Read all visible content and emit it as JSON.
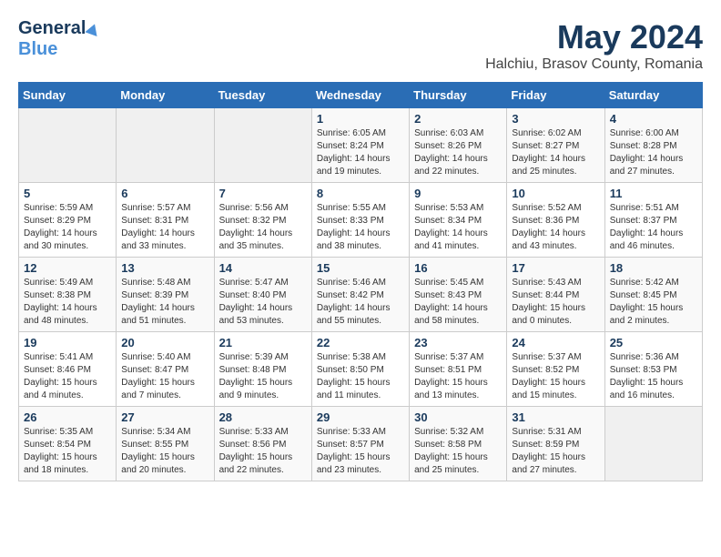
{
  "logo": {
    "general": "General",
    "blue": "Blue"
  },
  "header": {
    "month": "May 2024",
    "location": "Halchiu, Brasov County, Romania"
  },
  "weekdays": [
    "Sunday",
    "Monday",
    "Tuesday",
    "Wednesday",
    "Thursday",
    "Friday",
    "Saturday"
  ],
  "weeks": [
    [
      {
        "day": "",
        "info": ""
      },
      {
        "day": "",
        "info": ""
      },
      {
        "day": "",
        "info": ""
      },
      {
        "day": "1",
        "info": "Sunrise: 6:05 AM\nSunset: 8:24 PM\nDaylight: 14 hours\nand 19 minutes."
      },
      {
        "day": "2",
        "info": "Sunrise: 6:03 AM\nSunset: 8:26 PM\nDaylight: 14 hours\nand 22 minutes."
      },
      {
        "day": "3",
        "info": "Sunrise: 6:02 AM\nSunset: 8:27 PM\nDaylight: 14 hours\nand 25 minutes."
      },
      {
        "day": "4",
        "info": "Sunrise: 6:00 AM\nSunset: 8:28 PM\nDaylight: 14 hours\nand 27 minutes."
      }
    ],
    [
      {
        "day": "5",
        "info": "Sunrise: 5:59 AM\nSunset: 8:29 PM\nDaylight: 14 hours\nand 30 minutes."
      },
      {
        "day": "6",
        "info": "Sunrise: 5:57 AM\nSunset: 8:31 PM\nDaylight: 14 hours\nand 33 minutes."
      },
      {
        "day": "7",
        "info": "Sunrise: 5:56 AM\nSunset: 8:32 PM\nDaylight: 14 hours\nand 35 minutes."
      },
      {
        "day": "8",
        "info": "Sunrise: 5:55 AM\nSunset: 8:33 PM\nDaylight: 14 hours\nand 38 minutes."
      },
      {
        "day": "9",
        "info": "Sunrise: 5:53 AM\nSunset: 8:34 PM\nDaylight: 14 hours\nand 41 minutes."
      },
      {
        "day": "10",
        "info": "Sunrise: 5:52 AM\nSunset: 8:36 PM\nDaylight: 14 hours\nand 43 minutes."
      },
      {
        "day": "11",
        "info": "Sunrise: 5:51 AM\nSunset: 8:37 PM\nDaylight: 14 hours\nand 46 minutes."
      }
    ],
    [
      {
        "day": "12",
        "info": "Sunrise: 5:49 AM\nSunset: 8:38 PM\nDaylight: 14 hours\nand 48 minutes."
      },
      {
        "day": "13",
        "info": "Sunrise: 5:48 AM\nSunset: 8:39 PM\nDaylight: 14 hours\nand 51 minutes."
      },
      {
        "day": "14",
        "info": "Sunrise: 5:47 AM\nSunset: 8:40 PM\nDaylight: 14 hours\nand 53 minutes."
      },
      {
        "day": "15",
        "info": "Sunrise: 5:46 AM\nSunset: 8:42 PM\nDaylight: 14 hours\nand 55 minutes."
      },
      {
        "day": "16",
        "info": "Sunrise: 5:45 AM\nSunset: 8:43 PM\nDaylight: 14 hours\nand 58 minutes."
      },
      {
        "day": "17",
        "info": "Sunrise: 5:43 AM\nSunset: 8:44 PM\nDaylight: 15 hours\nand 0 minutes."
      },
      {
        "day": "18",
        "info": "Sunrise: 5:42 AM\nSunset: 8:45 PM\nDaylight: 15 hours\nand 2 minutes."
      }
    ],
    [
      {
        "day": "19",
        "info": "Sunrise: 5:41 AM\nSunset: 8:46 PM\nDaylight: 15 hours\nand 4 minutes."
      },
      {
        "day": "20",
        "info": "Sunrise: 5:40 AM\nSunset: 8:47 PM\nDaylight: 15 hours\nand 7 minutes."
      },
      {
        "day": "21",
        "info": "Sunrise: 5:39 AM\nSunset: 8:48 PM\nDaylight: 15 hours\nand 9 minutes."
      },
      {
        "day": "22",
        "info": "Sunrise: 5:38 AM\nSunset: 8:50 PM\nDaylight: 15 hours\nand 11 minutes."
      },
      {
        "day": "23",
        "info": "Sunrise: 5:37 AM\nSunset: 8:51 PM\nDaylight: 15 hours\nand 13 minutes."
      },
      {
        "day": "24",
        "info": "Sunrise: 5:37 AM\nSunset: 8:52 PM\nDaylight: 15 hours\nand 15 minutes."
      },
      {
        "day": "25",
        "info": "Sunrise: 5:36 AM\nSunset: 8:53 PM\nDaylight: 15 hours\nand 16 minutes."
      }
    ],
    [
      {
        "day": "26",
        "info": "Sunrise: 5:35 AM\nSunset: 8:54 PM\nDaylight: 15 hours\nand 18 minutes."
      },
      {
        "day": "27",
        "info": "Sunrise: 5:34 AM\nSunset: 8:55 PM\nDaylight: 15 hours\nand 20 minutes."
      },
      {
        "day": "28",
        "info": "Sunrise: 5:33 AM\nSunset: 8:56 PM\nDaylight: 15 hours\nand 22 minutes."
      },
      {
        "day": "29",
        "info": "Sunrise: 5:33 AM\nSunset: 8:57 PM\nDaylight: 15 hours\nand 23 minutes."
      },
      {
        "day": "30",
        "info": "Sunrise: 5:32 AM\nSunset: 8:58 PM\nDaylight: 15 hours\nand 25 minutes."
      },
      {
        "day": "31",
        "info": "Sunrise: 5:31 AM\nSunset: 8:59 PM\nDaylight: 15 hours\nand 27 minutes."
      },
      {
        "day": "",
        "info": ""
      }
    ]
  ]
}
